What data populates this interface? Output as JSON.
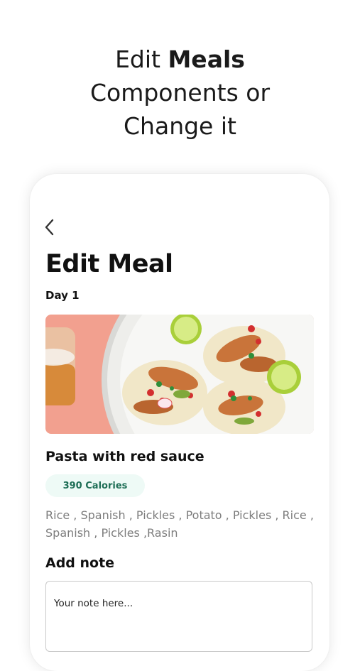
{
  "headline": {
    "line1_prefix": "Edit ",
    "line1_bold": "Meals",
    "line2": "Components or",
    "line3": "Change it"
  },
  "screen": {
    "back_icon": "chevron-left-icon",
    "title": "Edit Meal",
    "day": "Day 1",
    "meal_image": "tacos-photo",
    "meal_name": "Pasta with red sauce",
    "calories": "390 Calories",
    "ingredients": "Rice , Spanish , Pickles , Potato , Pickles , Rice , Spanish , Pickles ,Rasin",
    "note_label": "Add note",
    "note_placeholder": "Your note here..."
  },
  "colors": {
    "calorie_badge_bg": "#eefaf6",
    "calorie_badge_text": "#1f6f57",
    "image_bg": "#f2a08f"
  }
}
